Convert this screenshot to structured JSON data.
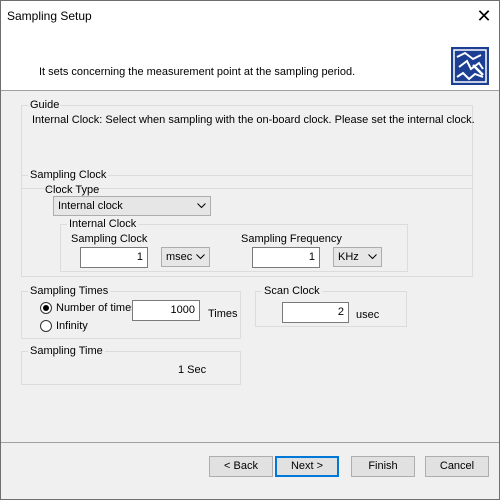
{
  "window": {
    "title": "Sampling Setup",
    "close_glyph": "✕"
  },
  "header": {
    "description": "It sets concerning the measurement point at the sampling period.",
    "logo_icon": "sampling-logo-icon"
  },
  "guide": {
    "label": "Guide",
    "text": "Internal Clock: Select when sampling with the on-board clock. Please set the internal clock."
  },
  "sampling_clock": {
    "label": "Sampling Clock",
    "clock_type_label": "Clock Type",
    "clock_type_value": "Internal clock",
    "internal_clock": {
      "label": "Internal Clock",
      "sampling_clock_label": "Sampling Clock",
      "sampling_clock_value": "1",
      "sampling_clock_unit": "msec",
      "sampling_frequency_label": "Sampling Frequency",
      "sampling_frequency_value": "1",
      "sampling_frequency_unit": "KHz"
    }
  },
  "sampling_times": {
    "label": "Sampling Times",
    "number_of_times_label": "Number of times",
    "number_of_times_value": "1000",
    "times_unit": "Times",
    "infinity_label": "Infinity",
    "selected": "number_of_times"
  },
  "scan_clock": {
    "label": "Scan Clock",
    "value": "2",
    "unit": "usec"
  },
  "sampling_time": {
    "label": "Sampling Time",
    "value": "1 Sec"
  },
  "buttons": {
    "back": "< Back",
    "next": "Next >",
    "finish": "Finish",
    "cancel": "Cancel"
  },
  "colors": {
    "accent": "#0078d7",
    "logo_blue": "#1c3f94"
  }
}
